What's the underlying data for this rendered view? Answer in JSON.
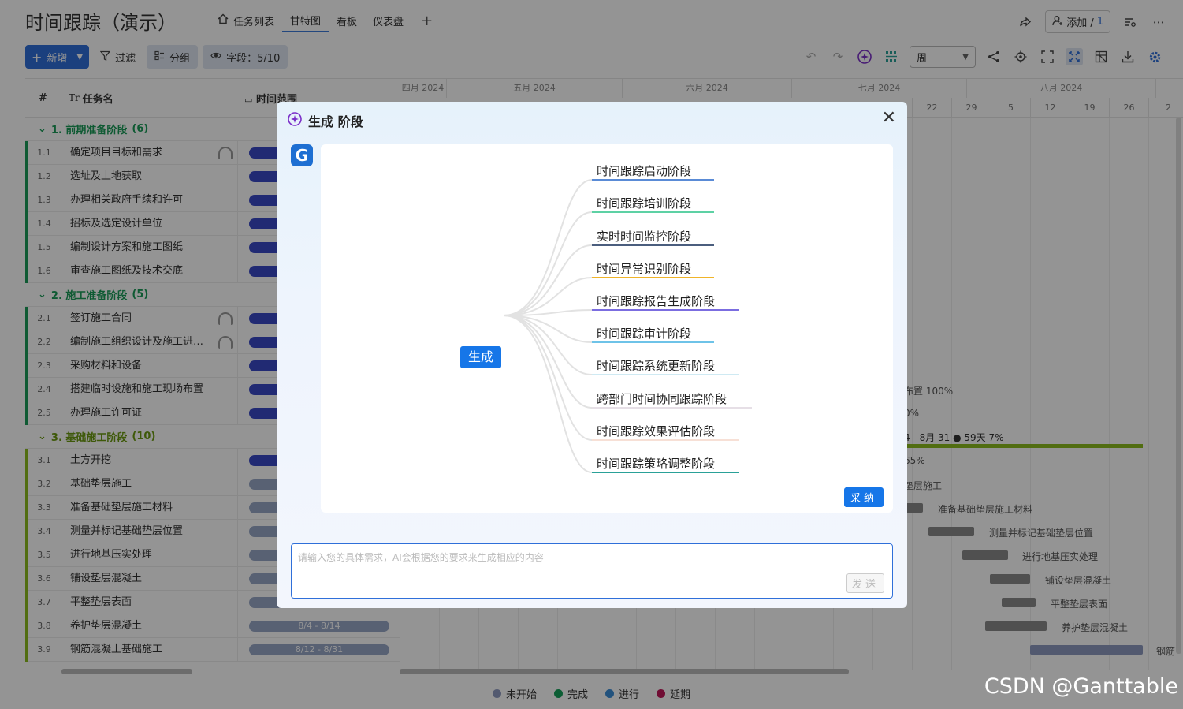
{
  "app": {
    "title": "时间跟踪（演示）",
    "tabs": [
      {
        "label": "任务列表",
        "icon": "home-icon"
      },
      {
        "label": "甘特图",
        "active": true
      },
      {
        "label": "看板"
      },
      {
        "label": "仪表盘"
      }
    ],
    "add_tab": "+",
    "add_member": {
      "label": "添加 / ",
      "count": "1"
    }
  },
  "toolbar": {
    "new_label": "新增",
    "filter_label": "过滤",
    "group_label": "分组",
    "fields_label": "字段：5/10",
    "view_select": "周"
  },
  "table": {
    "headers": {
      "num": "#",
      "name": "任务名",
      "range": "时间范围"
    },
    "groups": [
      {
        "title": "1. 前期准备阶段",
        "count": "(6)"
      },
      {
        "title": "2. 施工准备阶段",
        "count": "(5)"
      },
      {
        "title": "3. 基础施工阶段",
        "count": "(10)"
      }
    ],
    "rows": [
      {
        "num": "1.1",
        "name": "确定项目目标和需求"
      },
      {
        "num": "1.2",
        "name": "选址及土地获取"
      },
      {
        "num": "1.3",
        "name": "办理相关政府手续和许可"
      },
      {
        "num": "1.4",
        "name": "招标及选定设计单位"
      },
      {
        "num": "1.5",
        "name": "编制设计方案和施工图纸"
      },
      {
        "num": "1.6",
        "name": "审查施工图纸及技术交底"
      },
      {
        "num": "2.1",
        "name": "签订施工合同"
      },
      {
        "num": "2.2",
        "name": "编制施工组织设计及施工进度计划"
      },
      {
        "num": "2.3",
        "name": "采购材料和设备"
      },
      {
        "num": "2.4",
        "name": "搭建临时设施和施工现场布置"
      },
      {
        "num": "2.5",
        "name": "办理施工许可证"
      },
      {
        "num": "3.1",
        "name": "土方开挖"
      },
      {
        "num": "3.2",
        "name": "基础垫层施工"
      },
      {
        "num": "3.3",
        "name": "准备基础垫层施工材料"
      },
      {
        "num": "3.4",
        "name": "测量并标记基础垫层位置"
      },
      {
        "num": "3.5",
        "name": "进行地基压实处理"
      },
      {
        "num": "3.6",
        "name": "铺设垫层混凝土"
      },
      {
        "num": "3.7",
        "name": "平整垫层表面"
      },
      {
        "num": "3.8",
        "name": "养护垫层混凝土",
        "bar": "8/4 - 8/14"
      },
      {
        "num": "3.9",
        "name": "钢筋混凝土基础施工",
        "bar": "8/12 - 8/31"
      }
    ]
  },
  "gantt": {
    "months": [
      "四月 2024",
      "五月 2024",
      "六月 2024",
      "七月 2024",
      "八月 2024"
    ],
    "days": [
      "22",
      "29",
      "5",
      "12",
      "19",
      "26",
      "2"
    ],
    "labels": {
      "l1": "布置 100%",
      "l2": "0%",
      "l3": "4 - 8月 31 ● 59天 7%",
      "l4": "65%",
      "l5": "垫层施工",
      "l6": "准备基础垫层施工材料",
      "l7": "测量并标记基础垫层位置",
      "l8": "进行地基压实处理",
      "l9": "铺设垫层混凝土",
      "l10": "平整垫层表面",
      "l11": "养护垫层混凝土",
      "l12": "钢筋"
    }
  },
  "legend": [
    {
      "label": "未开始",
      "color": "#8e9ac0"
    },
    {
      "label": "完成",
      "color": "#16a05a"
    },
    {
      "label": "进行",
      "color": "#3b8ed8"
    },
    {
      "label": "延期",
      "color": "#c2185b"
    }
  ],
  "watermark": "CSDN @Ganttable",
  "modal": {
    "title": "生成 阶段",
    "logo": "G",
    "root": "生成",
    "nodes": [
      {
        "label": "时间跟踪启动阶段",
        "color": "#5a8bd6"
      },
      {
        "label": "时间跟踪培训阶段",
        "color": "#5dd1a4"
      },
      {
        "label": "实时时间监控阶段",
        "color": "#4b5e7e"
      },
      {
        "label": "时间异常识别阶段",
        "color": "#f0b429"
      },
      {
        "label": "时间跟踪报告生成阶段",
        "color": "#7b6de0"
      },
      {
        "label": "时间跟踪审计阶段",
        "color": "#6ec3e8"
      },
      {
        "label": "时间跟踪系统更新阶段",
        "color": "#cfeaf3"
      },
      {
        "label": "跨部门时间协同跟踪阶段",
        "color": "#e6dfe6"
      },
      {
        "label": "时间跟踪效果评估阶段",
        "color": "#f7e0d6"
      },
      {
        "label": "时间跟踪策略调整阶段",
        "color": "#2aa198"
      }
    ],
    "adopt_label": "采纳",
    "input_placeholder": "请输入您的具体需求，AI会根据您的要求来生成相应的内容",
    "send_label": "发送"
  }
}
